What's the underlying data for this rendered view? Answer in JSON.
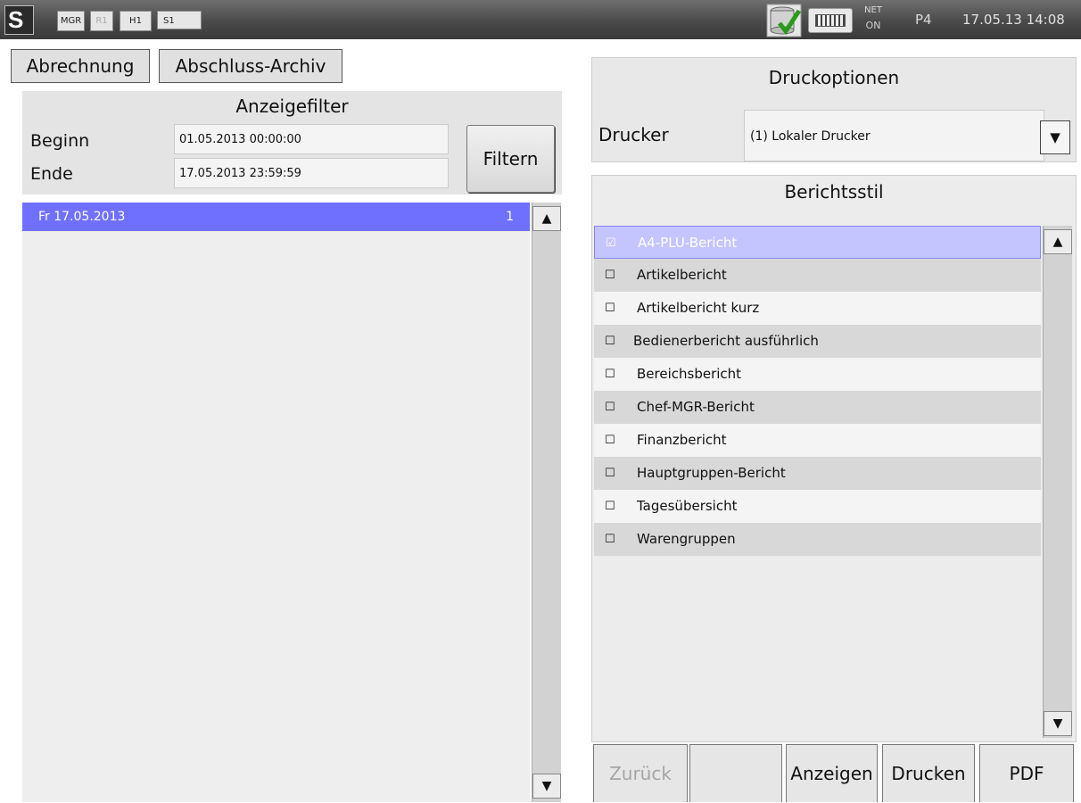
{
  "statusbar": {
    "tags": [
      "MGR",
      "R1",
      "H1",
      "S1"
    ],
    "net_label": "NET",
    "net_status": "ON",
    "terminal": "P4",
    "datetime": "17.05.13 14:08"
  },
  "tabs": {
    "abrechnung": "Abrechnung",
    "archiv": "Abschluss-Archiv"
  },
  "filter": {
    "title": "Anzeigefilter",
    "begin_label": "Beginn",
    "begin_value": "01.05.2013 00:00:00",
    "end_label": "Ende",
    "end_value": "17.05.2013 23:59:59",
    "filter_button": "Filtern"
  },
  "days": [
    {
      "label": "Fr 17.05.2013",
      "count": "1"
    }
  ],
  "print_options": {
    "title": "Druckoptionen",
    "printer_label": "Drucker",
    "printer_value": "(1) Lokaler Drucker"
  },
  "report_style": {
    "title": "Berichtsstil",
    "items": [
      {
        "label": "A4-PLU-Bericht",
        "checked": true
      },
      {
        "label": "Artikelbericht",
        "checked": false
      },
      {
        "label": "Artikelbericht kurz",
        "checked": false
      },
      {
        "label": "Bedienerbericht ausführlich",
        "checked": false
      },
      {
        "label": "Bereichsbericht",
        "checked": false
      },
      {
        "label": "Chef-MGR-Bericht",
        "checked": false
      },
      {
        "label": "Finanzbericht",
        "checked": false
      },
      {
        "label": "Hauptgruppen-Bericht",
        "checked": false
      },
      {
        "label": "Tagesübersicht",
        "checked": false
      },
      {
        "label": "Warengruppen",
        "checked": false
      }
    ]
  },
  "actions": {
    "back": "Zurück",
    "show": "Anzeigen",
    "print": "Drucken",
    "pdf": "PDF"
  },
  "glyphs": {
    "scroll_up": "▲",
    "scroll_down": "▼",
    "dropdown": "▼",
    "checked": "☑",
    "unchecked": "☐"
  },
  "colors": {
    "selection": "#7070ff",
    "selected_row": "#c4c4ff"
  }
}
